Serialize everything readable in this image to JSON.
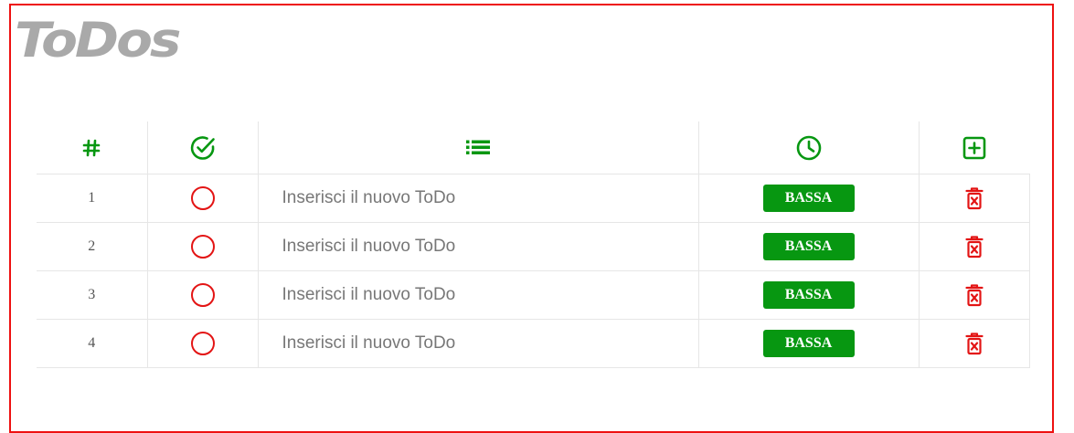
{
  "app": {
    "title": "ToDos"
  },
  "colors": {
    "accent": "#079711",
    "danger": "#e31414",
    "frame": "#ee1111",
    "title": "#a9a9a9"
  },
  "header": {
    "columns": [
      {
        "icon": "hash-icon"
      },
      {
        "icon": "check-circle-icon"
      },
      {
        "icon": "list-icon"
      },
      {
        "icon": "clock-icon"
      },
      {
        "icon": "plus-square-icon"
      }
    ]
  },
  "rows": [
    {
      "number": "1",
      "placeholder": "Inserisci il nuovo ToDo",
      "priority": "BASSA"
    },
    {
      "number": "2",
      "placeholder": "Inserisci il nuovo ToDo",
      "priority": "BASSA"
    },
    {
      "number": "3",
      "placeholder": "Inserisci il nuovo ToDo",
      "priority": "BASSA"
    },
    {
      "number": "4",
      "placeholder": "Inserisci il nuovo ToDo",
      "priority": "BASSA"
    }
  ]
}
